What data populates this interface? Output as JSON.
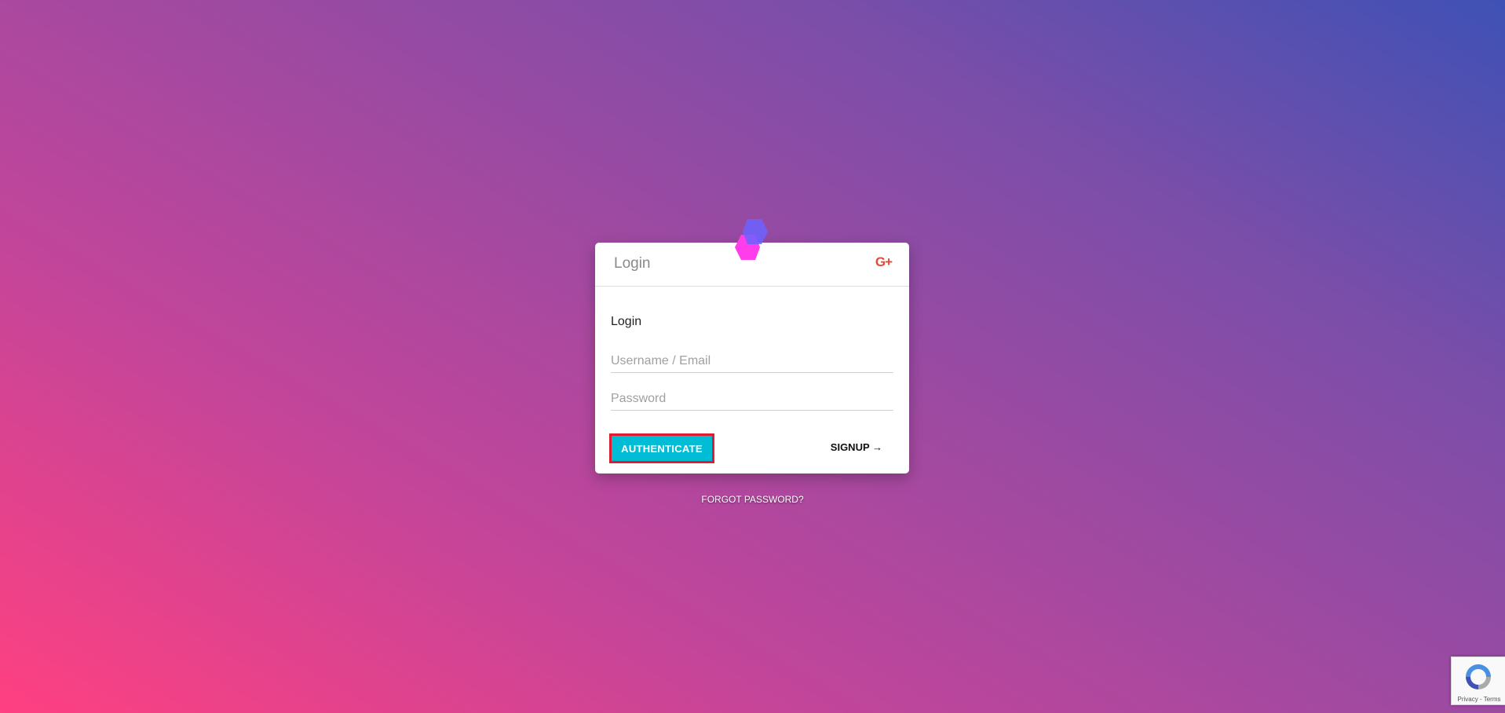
{
  "card": {
    "header_title": "Login",
    "gplus_label": "G+",
    "form_label": "Login",
    "username_placeholder": "Username / Email",
    "password_placeholder": "Password",
    "authenticate_label": "AUTHENTICATE",
    "signup_label": "SIGNUP →"
  },
  "forgot_password_label": "FORGOT PASSWORD?",
  "recaptcha": {
    "links": "Privacy - Terms"
  },
  "colors": {
    "accent_button": "#00bcd4",
    "highlight_border": "#e01c2e",
    "google_plus": "#e04a3a",
    "gradient_start": "#ff4081",
    "gradient_end": "#3f51b5"
  },
  "icons": {
    "logo": "overlapping-hexagons-logo",
    "social": "google-plus-icon",
    "captcha": "recaptcha-icon"
  }
}
